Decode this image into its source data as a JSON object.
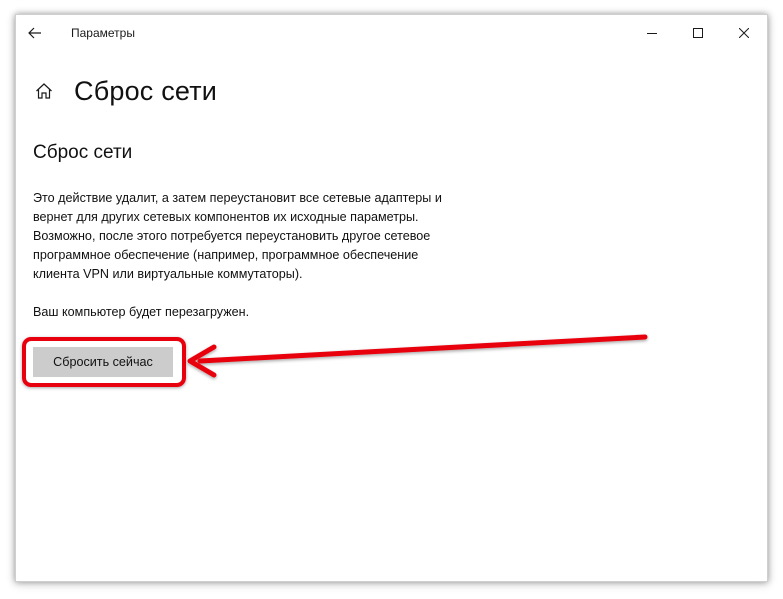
{
  "window": {
    "title": "Параметры"
  },
  "header": {
    "page_title": "Сброс сети"
  },
  "section": {
    "title": "Сброс сети",
    "description_lines": [
      "Это действие удалит, а затем переустановит все сетевые адаптеры и",
      "вернет для других сетевых компонентов их исходные параметры.",
      "Возможно, после этого потребуется переустановить другое сетевое",
      "программное обеспечение (например, программное обеспечение",
      "клиента VPN или виртуальные коммутаторы)."
    ],
    "restart_note": "Ваш компьютер будет перезагружен.",
    "reset_button_label": "Сбросить сейчас"
  },
  "icons": {
    "back": "arrow-left-icon",
    "home": "home-icon",
    "minimize": "minimize-icon",
    "maximize": "maximize-icon",
    "close": "close-icon"
  },
  "colors": {
    "highlight": "#e8000f",
    "button_bg": "#cccccc"
  }
}
